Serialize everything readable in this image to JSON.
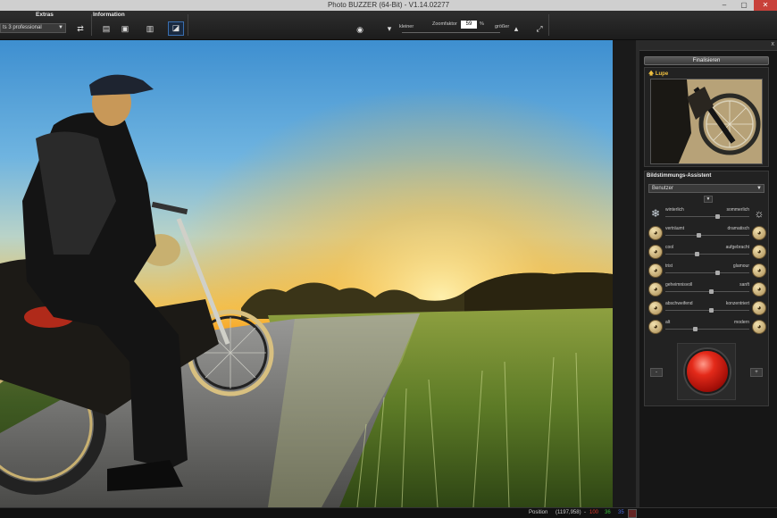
{
  "window": {
    "title": "Photo BUZZER (64-Bit) - V1.14.02277",
    "minimize": "–",
    "maximize": "▢",
    "close": "✕"
  },
  "toolbar": {
    "extras_label": "Extras",
    "information_label": "Information",
    "preset_value": "ts 3 professional",
    "zoom_smaller_label": "kleiner",
    "zoom_factor_label": "Zoomfaktor",
    "zoom_value": "59",
    "zoom_unit": "%",
    "zoom_larger_label": "größer"
  },
  "panel": {
    "close": "x",
    "finalize_button": "Finalisieren",
    "lupe_title": "Lupe",
    "assistant_title": "Bildstimmungs-Assistent",
    "assistant_select": "Benutzer",
    "mood_rows": [
      {
        "left": "winterlich",
        "right": "sommerlich",
        "left_icon": "snowflake-icon",
        "right_icon": "sun-icon",
        "level": 0.62
      },
      {
        "left": "verträumt",
        "right": "dramatisch",
        "left_icon": "dreamy-face-icon",
        "right_icon": "dramatic-face-icon",
        "level": 0.4
      },
      {
        "left": "cool",
        "right": "aufgebracht",
        "left_icon": "cool-face-icon",
        "right_icon": "angry-face-icon",
        "level": 0.38
      },
      {
        "left": "trist",
        "right": "glamour",
        "left_icon": "sad-face-icon",
        "right_icon": "glamour-face-icon",
        "level": 0.62
      },
      {
        "left": "geheimnisvoll",
        "right": "sanft",
        "left_icon": "mysterious-face-icon",
        "right_icon": "gentle-face-icon",
        "level": 0.55
      },
      {
        "left": "abschweifend",
        "right": "konzentriert",
        "left_icon": "wandering-face-icon",
        "right_icon": "focused-face-icon",
        "level": 0.55
      },
      {
        "left": "alt",
        "right": "modern",
        "left_icon": "old-face-icon",
        "right_icon": "modern-face-icon",
        "level": 0.36
      }
    ],
    "minus_button": "-",
    "plus_button": "+"
  },
  "status": {
    "position_label": "Position",
    "position_value": "(1197,958)",
    "dash": "-",
    "r": "100",
    "g": "36",
    "b": "35",
    "r_color": "#e03a2a",
    "g_color": "#3cc03c",
    "b_color": "#4a6ae0",
    "swatch_color": "#642423"
  }
}
